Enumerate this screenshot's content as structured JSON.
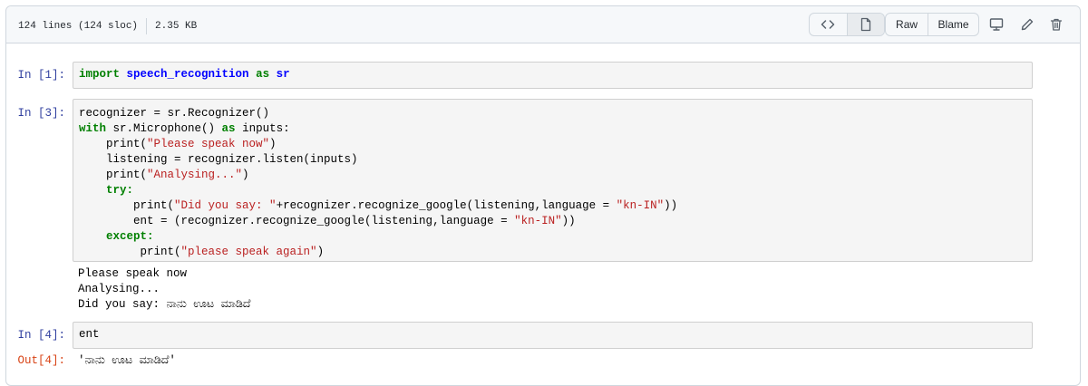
{
  "file_header": {
    "lines": "124 lines (124 sloc)",
    "size": "2.35 KB",
    "raw_label": "Raw",
    "blame_label": "Blame",
    "icons": [
      "code-icon",
      "file-icon",
      "desktop-icon",
      "pencil-icon",
      "trash-icon"
    ]
  },
  "cells": {
    "c1": {
      "prompt": "In [1]:",
      "code": {
        "kw1": "import",
        "module": "speech_recognition",
        "kw2": "as",
        "alias": "sr"
      }
    },
    "c2": {
      "prompt": "In [3]:",
      "code": {
        "l1": "recognizer = sr.Recognizer()",
        "l2_kw": "with",
        "l2_a": " sr.Microphone() ",
        "l2_kw2": "as",
        "l2_b": " inputs:",
        "l3_a": "    print(",
        "l3_s": "\"Please speak now\"",
        "l3_b": ")",
        "l4": "    listening = recognizer.listen(inputs)",
        "l5_a": "    print(",
        "l5_s": "\"Analysing...\"",
        "l5_b": ")",
        "l6_kw": "    try:",
        "l7_a": "        print(",
        "l7_s1": "\"Did you say: \"",
        "l7_b": "+recognizer.recognize_google(listening,language = ",
        "l7_s2": "\"kn-IN\"",
        "l7_c": "))",
        "l8_a": "        ent = (recognizer.recognize_google(listening,language = ",
        "l8_s": "\"kn-IN\"",
        "l8_b": "))",
        "l9_kw": "    except:",
        "l10_a": "         print(",
        "l10_s": "\"please speak again\"",
        "l10_b": ")"
      },
      "output": [
        "Please speak now",
        "Analysing...",
        "Did you say: ನಾನು ಊಟ ಮಾಡಿದೆ"
      ]
    },
    "c3": {
      "prompt": "In [4]:",
      "code": "ent",
      "out_prompt": "Out[4]:",
      "output": "'ನಾನು ಊಟ ಮಾಡಿದೆ'"
    }
  }
}
